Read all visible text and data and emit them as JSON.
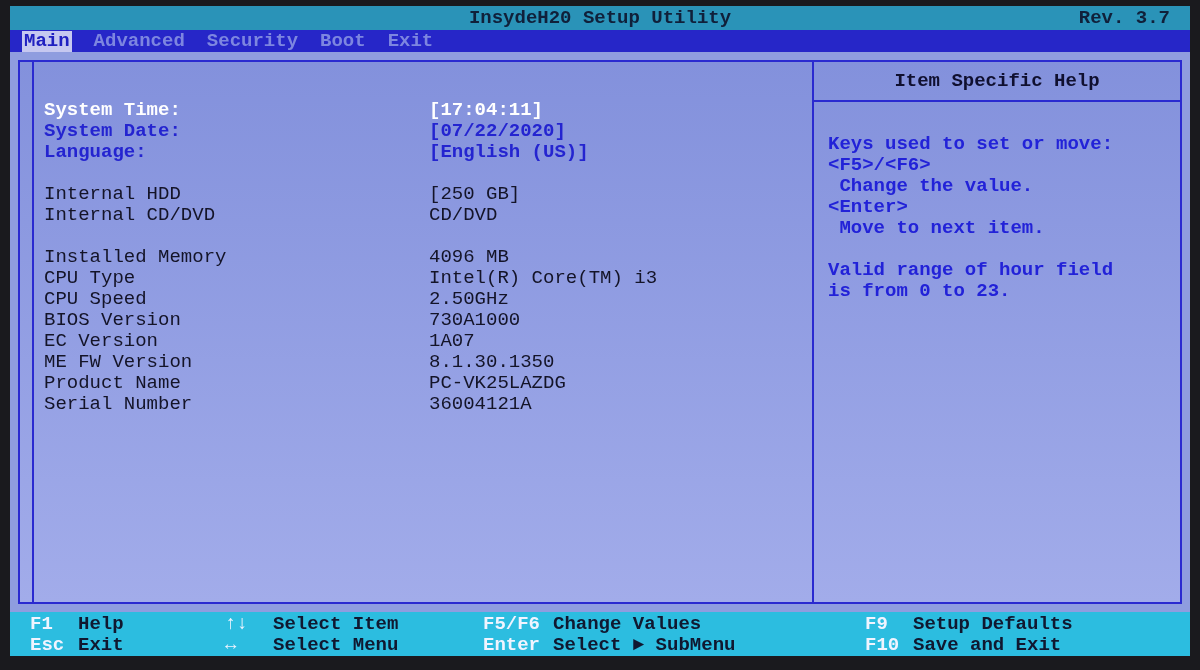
{
  "window": {
    "title": "InsydeH20 Setup Utility",
    "revision": "Rev. 3.7"
  },
  "tabs": [
    {
      "label": "Main",
      "selected": true
    },
    {
      "label": "Advanced",
      "selected": false
    },
    {
      "label": "Security",
      "selected": false
    },
    {
      "label": "Boot",
      "selected": false
    },
    {
      "label": "Exit",
      "selected": false
    }
  ],
  "groups": [
    [
      {
        "kind": "setting",
        "label": "System Time:",
        "value": "[17:04:11]",
        "selected": true
      },
      {
        "kind": "setting",
        "label": "System Date:",
        "value": "[07/22/2020]",
        "selected": false
      },
      {
        "kind": "setting",
        "label": "Language:",
        "value": "[English (US)]",
        "selected": false
      }
    ],
    [
      {
        "kind": "info",
        "label": "Internal HDD",
        "value": "[250 GB]"
      },
      {
        "kind": "info",
        "label": "Internal CD/DVD",
        "value": "CD/DVD"
      }
    ],
    [
      {
        "kind": "info",
        "label": "Installed Memory",
        "value": "4096 MB"
      },
      {
        "kind": "info",
        "label": "CPU Type",
        "value": "Intel(R) Core(TM) i3"
      },
      {
        "kind": "info",
        "label": "CPU Speed",
        "value": "2.50GHz"
      },
      {
        "kind": "info",
        "label": "BIOS Version",
        "value": "730A1000"
      },
      {
        "kind": "info",
        "label": "EC Version",
        "value": "1A07"
      },
      {
        "kind": "info",
        "label": "ME FW Version",
        "value": "8.1.30.1350"
      },
      {
        "kind": "info",
        "label": "Product Name",
        "value": "PC-VK25LAZDG"
      },
      {
        "kind": "info",
        "label": "Serial Number",
        "value": "36004121A"
      }
    ]
  ],
  "help": {
    "title": "Item Specific Help",
    "paragraphs": [
      [
        "Keys used to set or move:",
        "<F5>/<F6>",
        " Change the value.",
        "<Enter>",
        " Move to next item."
      ],
      [
        "Valid range of hour field",
        "is from 0 to 23."
      ]
    ]
  },
  "footer": [
    [
      {
        "key": "F1",
        "action": "Help"
      },
      {
        "key": "Esc",
        "action": "Exit"
      }
    ],
    [
      {
        "key": "↑↓",
        "action": "Select Item"
      },
      {
        "key": "↔",
        "action": "Select Menu"
      }
    ],
    [
      {
        "key": "F5/F6",
        "action": "Change Values"
      },
      {
        "key": "Enter",
        "action": "Select ► SubMenu"
      }
    ],
    [
      {
        "key": "F9",
        "action": "Setup Defaults"
      },
      {
        "key": "F10",
        "action": "Save and Exit"
      }
    ]
  ]
}
